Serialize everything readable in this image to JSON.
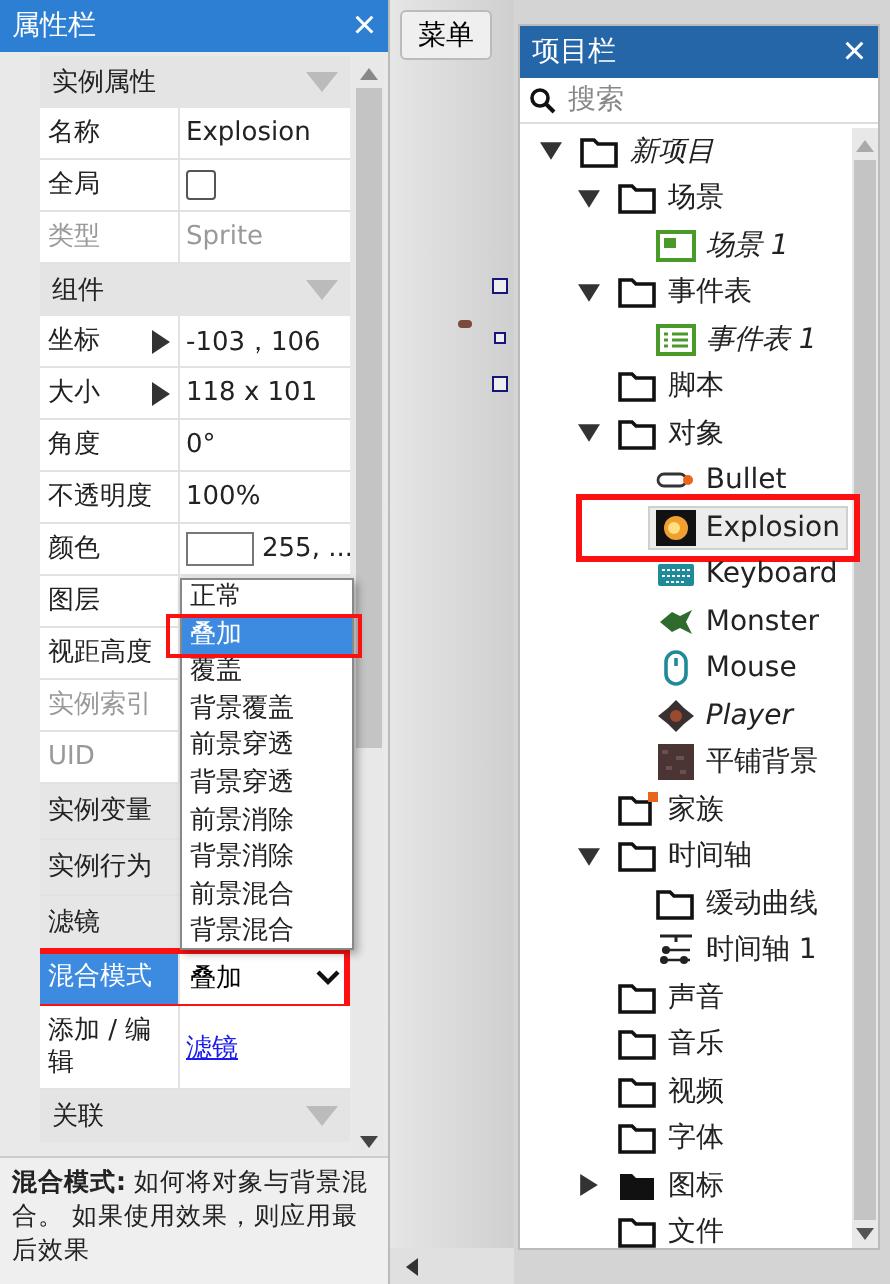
{
  "properties": {
    "title": "属性栏",
    "close": "×",
    "sections": [
      {
        "title": "实例属性",
        "rows": [
          {
            "kind": "text",
            "label": "名称",
            "value": "Explosion",
            "disabled": false,
            "selected": false,
            "highlighted": false
          },
          {
            "kind": "checkbox",
            "label": "全局",
            "checked": false,
            "disabled": false,
            "selected": false,
            "highlighted": false
          },
          {
            "kind": "text",
            "label": "类型",
            "value": "Sprite",
            "disabled": true,
            "selected": false,
            "highlighted": false
          }
        ]
      },
      {
        "title": "组件",
        "rows": [
          {
            "kind": "expandable",
            "label": "坐标",
            "value": "-103，106",
            "disabled": false,
            "selected": false,
            "highlighted": false
          },
          {
            "kind": "expandable",
            "label": "大小",
            "value": "118 x 101",
            "disabled": false,
            "selected": false,
            "highlighted": false
          },
          {
            "kind": "text",
            "label": "角度",
            "value": "0°",
            "disabled": false,
            "selected": false,
            "highlighted": false
          },
          {
            "kind": "text",
            "label": "不透明度",
            "value": "100%",
            "disabled": false,
            "selected": false,
            "highlighted": false
          },
          {
            "kind": "color",
            "label": "颜色",
            "value": "255, ...",
            "color": "#ffffff",
            "disabled": false,
            "selected": false,
            "highlighted": false
          },
          {
            "kind": "text",
            "label": "图层",
            "disabled": false,
            "selected": false,
            "highlighted": false
          },
          {
            "kind": "text",
            "label": "视距高度",
            "disabled": false,
            "selected": false,
            "highlighted": false
          },
          {
            "kind": "text",
            "label": "实例索引",
            "disabled": true,
            "selected": false,
            "highlighted": false
          },
          {
            "kind": "text",
            "label": "UID",
            "disabled": true,
            "selected": false,
            "highlighted": false
          },
          {
            "kind": "group",
            "label": "实例变量",
            "disabled": false,
            "selected": false,
            "highlighted": false
          },
          {
            "kind": "group",
            "label": "实例行为",
            "disabled": false,
            "selected": false,
            "highlighted": false
          },
          {
            "kind": "group",
            "label": "滤镜",
            "disabled": false,
            "selected": false,
            "highlighted": false
          },
          {
            "kind": "dropdown",
            "label": "混合模式",
            "value": "叠加",
            "disabled": false,
            "selected": true,
            "highlighted": true
          },
          {
            "kind": "link",
            "label": "添加 / 编辑",
            "value": "滤镜",
            "disabled": false,
            "selected": false,
            "highlighted": false
          }
        ]
      },
      {
        "title": "关联"
      }
    ],
    "dropdown_options": [
      {
        "label": "正常",
        "selected": false,
        "highlighted": false
      },
      {
        "label": "叠加",
        "selected": true,
        "highlighted": true
      },
      {
        "label": "覆盖",
        "selected": false,
        "highlighted": false
      },
      {
        "label": "背景覆盖",
        "selected": false,
        "highlighted": false
      },
      {
        "label": "前景穿透",
        "selected": false,
        "highlighted": false
      },
      {
        "label": "背景穿透",
        "selected": false,
        "highlighted": false
      },
      {
        "label": "前景消除",
        "selected": false,
        "highlighted": false
      },
      {
        "label": "背景消除",
        "selected": false,
        "highlighted": false
      },
      {
        "label": "前景混合",
        "selected": false,
        "highlighted": false
      },
      {
        "label": "背景混合",
        "selected": false,
        "highlighted": false
      }
    ],
    "description": "**混合模式:** 如何将对象与背景混合。 如果使用效果，则应用最后效果"
  },
  "canvas": {
    "menu_button": "菜单"
  },
  "project": {
    "title": "项目栏",
    "close": "×",
    "search": {
      "placeholder": "搜索"
    },
    "tree": [
      {
        "label": "新项目",
        "kind": "folder",
        "expanded": true,
        "italic": true,
        "selected": false,
        "highlighted": false,
        "children": [
          {
            "label": "场景",
            "kind": "folder",
            "expanded": true,
            "italic": false,
            "selected": false,
            "highlighted": false,
            "children": [
              {
                "label": "场景 1",
                "kind": "layout",
                "italic": true,
                "selected": false,
                "highlighted": false
              }
            ]
          },
          {
            "label": "事件表",
            "kind": "folder",
            "expanded": true,
            "italic": false,
            "selected": false,
            "highlighted": false,
            "children": [
              {
                "label": "事件表 1",
                "kind": "event-sheet",
                "italic": true,
                "selected": false,
                "highlighted": false
              }
            ]
          },
          {
            "label": "脚本",
            "kind": "folder",
            "italic": false,
            "selected": false,
            "highlighted": false
          },
          {
            "label": "对象",
            "kind": "folder",
            "expanded": true,
            "italic": false,
            "selected": false,
            "highlighted": false,
            "children": [
              {
                "label": "Bullet",
                "kind": "bullet",
                "italic": false,
                "selected": false,
                "highlighted": false
              },
              {
                "label": "Explosion",
                "kind": "explosion",
                "italic": false,
                "selected": true,
                "highlighted": true
              },
              {
                "label": "Keyboard",
                "kind": "keyboard",
                "italic": false,
                "selected": false,
                "highlighted": false
              },
              {
                "label": "Monster",
                "kind": "monster",
                "italic": false,
                "selected": false,
                "highlighted": false
              },
              {
                "label": "Mouse",
                "kind": "mouse",
                "italic": false,
                "selected": false,
                "highlighted": false
              },
              {
                "label": "Player",
                "kind": "player",
                "italic": true,
                "selected": false,
                "highlighted": false
              },
              {
                "label": "平铺背景",
                "kind": "tiled",
                "italic": false,
                "selected": false,
                "highlighted": false
              }
            ]
          },
          {
            "label": "家族",
            "kind": "family",
            "italic": false,
            "selected": false,
            "highlighted": false
          },
          {
            "label": "时间轴",
            "kind": "folder",
            "expanded": true,
            "italic": false,
            "selected": false,
            "highlighted": false,
            "children": [
              {
                "label": "缓动曲线",
                "kind": "folder",
                "italic": false,
                "selected": false,
                "highlighted": false
              },
              {
                "label": "时间轴 1",
                "kind": "timeline",
                "italic": false,
                "selected": false,
                "highlighted": false
              }
            ]
          },
          {
            "label": "声音",
            "kind": "folder",
            "italic": false,
            "selected": false,
            "highlighted": false
          },
          {
            "label": "音乐",
            "kind": "folder",
            "italic": false,
            "selected": false,
            "highlighted": false
          },
          {
            "label": "视频",
            "kind": "folder",
            "italic": false,
            "selected": false,
            "highlighted": false
          },
          {
            "label": "字体",
            "kind": "folder",
            "italic": false,
            "selected": false,
            "highlighted": false
          },
          {
            "label": "图标",
            "kind": "icons",
            "expanded": false,
            "italic": false,
            "selected": false,
            "highlighted": false
          },
          {
            "label": "文件",
            "kind": "folder",
            "italic": false,
            "selected": false,
            "highlighted": false
          }
        ]
      }
    ]
  }
}
